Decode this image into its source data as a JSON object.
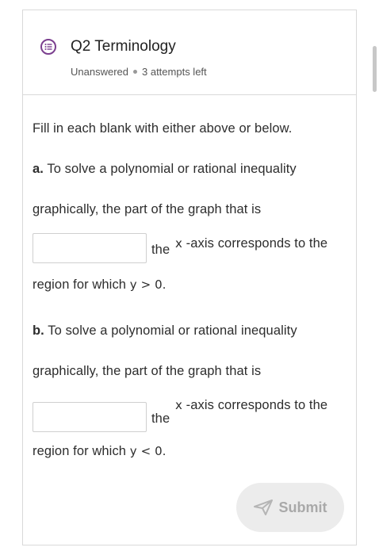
{
  "question": {
    "title": "Q2 Terminology",
    "status": "Unanswered",
    "attempts": "3 attempts left"
  },
  "instructions": "Fill in each blank with either above or below.",
  "part_a": {
    "label": "a.",
    "line1": "To solve a polynomial or rational inequality",
    "line2": "graphically, the part of the graph that is",
    "after_blank_the": "the",
    "after_blank_x": "x",
    "after_blank_rest": "-axis corresponds to the",
    "line4_prefix": "region for which",
    "condition": "y > 0",
    "line4_suffix": "."
  },
  "part_b": {
    "label": "b.",
    "line1": "To solve a polynomial or rational inequality",
    "line2": "graphically, the part of the graph that is",
    "after_blank_the": "the",
    "after_blank_x": "x",
    "after_blank_rest": "-axis corresponds to the",
    "line4_prefix": "region for which",
    "condition": "y < 0",
    "line4_suffix": "."
  },
  "blank_a_value": "",
  "blank_b_value": "",
  "submit_label": "Submit",
  "colors": {
    "icon": "#7b3f8f",
    "submit_bg": "#ececec",
    "submit_text": "#a9a9a9"
  }
}
